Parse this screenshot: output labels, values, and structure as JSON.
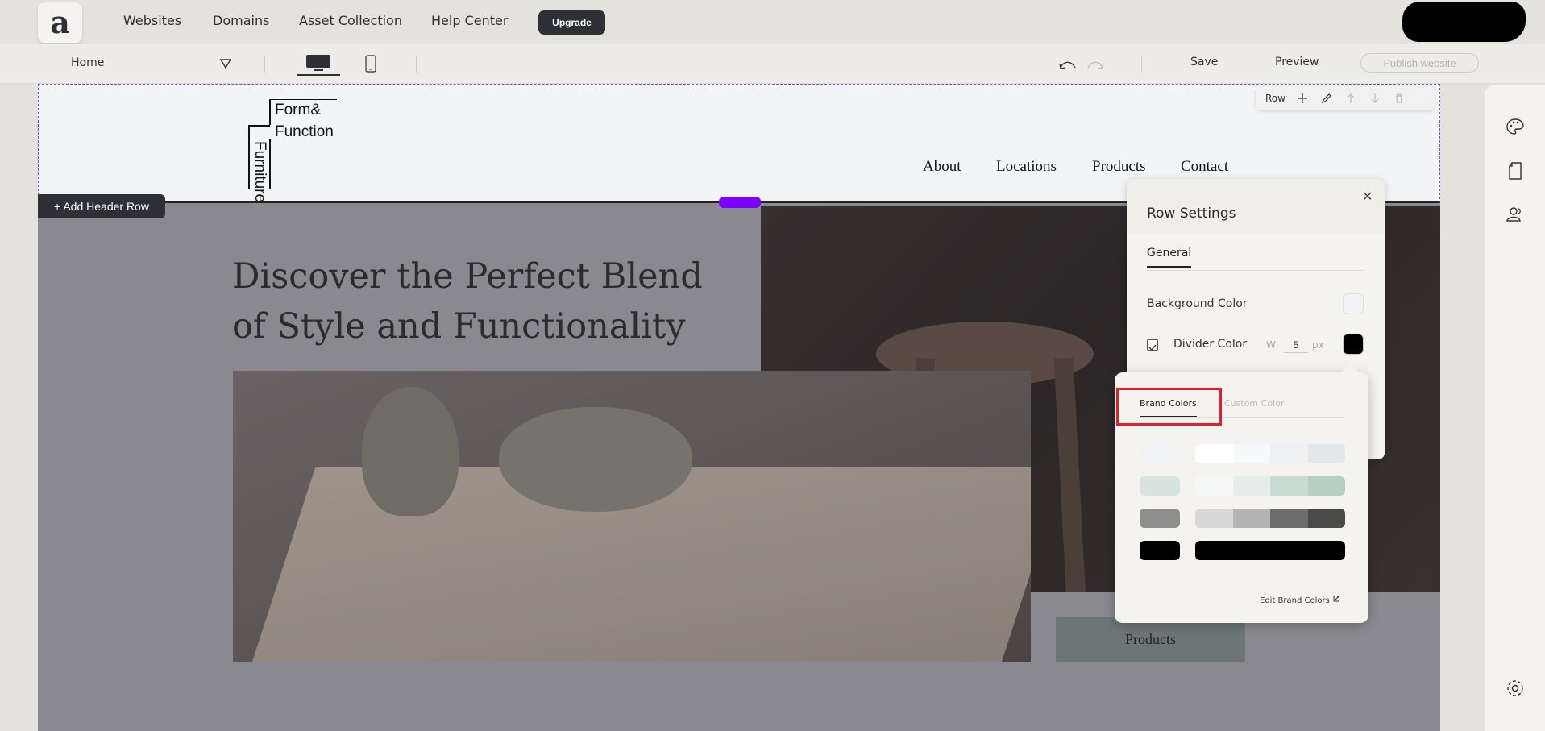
{
  "topnav": {
    "logo_letter": "a",
    "links": [
      "Websites",
      "Domains",
      "Asset Collection",
      "Help Center"
    ],
    "upgrade_label": "Upgrade"
  },
  "toolbar": {
    "page": "Home",
    "save_label": "Save",
    "preview_label": "Preview",
    "publish_label": "Publish website"
  },
  "site_header": {
    "brand_line1": "Form&",
    "brand_line2": "Function",
    "brand_vertical": "Furniture",
    "menu": [
      "About",
      "Locations",
      "Products",
      "Contact"
    ],
    "row_tools_label": "Row",
    "add_header_row_label": "+ Add Header Row"
  },
  "hero": {
    "title": "Discover the Perfect Blend of Style and Functionality",
    "products_button": "Products"
  },
  "row_settings": {
    "title": "Row Settings",
    "tab": "General",
    "background_color_label": "Background Color",
    "divider_color_label": "Divider Color",
    "divider_enabled": true,
    "width_label": "W",
    "width_value": "5",
    "width_unit": "px"
  },
  "color_picker": {
    "tabs": [
      "Brand Colors",
      "Custom Color"
    ],
    "active_tab": "Brand Colors",
    "brand_colors": [
      {
        "main": "#f1f2f4",
        "scale": [
          "#ffffff",
          "#f7f8f9",
          "#eef0f2",
          "#e4e7ea"
        ]
      },
      {
        "main": "#d6e3de",
        "scale": [
          "#f4f7f6",
          "#e6eeeb",
          "#c8dcd4",
          "#b5cfc4"
        ]
      },
      {
        "main": "#8e8e8c",
        "scale": [
          "#d8d8d6",
          "#b4b4b2",
          "#6d6d6b",
          "#4a4a48"
        ]
      },
      {
        "main": "#000000",
        "scale": [
          "#000000",
          "#000000",
          "#000000",
          "#000000"
        ]
      }
    ],
    "edit_label": "Edit Brand Colors"
  },
  "colors": {
    "accent_purple": "#7a00ff",
    "dark": "#2e3036",
    "highlight_red": "#e0202a"
  }
}
